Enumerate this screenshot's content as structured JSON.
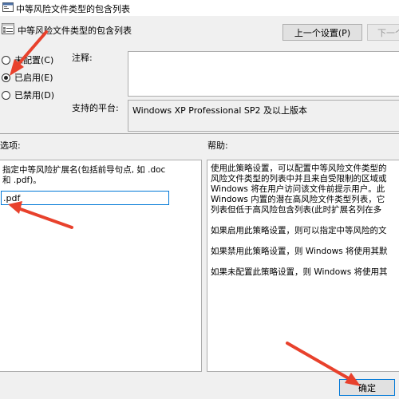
{
  "window": {
    "title": "中等风险文件类型的包含列表"
  },
  "header": {
    "title": "中等风险文件类型的包含列表",
    "prev_button": "上一个设置(P)",
    "next_button": "下一个"
  },
  "state": {
    "options": [
      {
        "label": "未配置(C)",
        "checked": false
      },
      {
        "label": "已启用(E)",
        "checked": true
      },
      {
        "label": "已禁用(D)",
        "checked": false
      }
    ]
  },
  "comment": {
    "label": "注释:"
  },
  "platform": {
    "label": "支持的平台:",
    "value": "Windows XP Professional SP2 及以上版本"
  },
  "options_section": {
    "label": "选项:",
    "description_line1": "指定中等风险扩展名(包括前导句点, 如 .doc",
    "description_line2": "和 .pdf)。",
    "input_value": ".pdf"
  },
  "help_section": {
    "label": "帮助:",
    "para1": [
      "使用此策略设置，可以配置中等风险文件类型的",
      "风险文件类型的列表中并且来自受限制的区域或",
      "Windows 将在用户访问该文件前提示用户。此",
      "Windows 内置的潜在高风险文件类型列表，它",
      "列表但低于高风险包含列表(此时扩展名列在多"
    ],
    "para2": "如果启用此策略设置，则可以指定中等风险的文",
    "para3": "如果禁用此策略设置，则 Windows 将使用其默",
    "para4": "如果未配置此策略设置，则 Windows 将使用其"
  },
  "footer": {
    "ok_button": "确定"
  },
  "colors": {
    "annotation_arrow": "#e8412c"
  }
}
